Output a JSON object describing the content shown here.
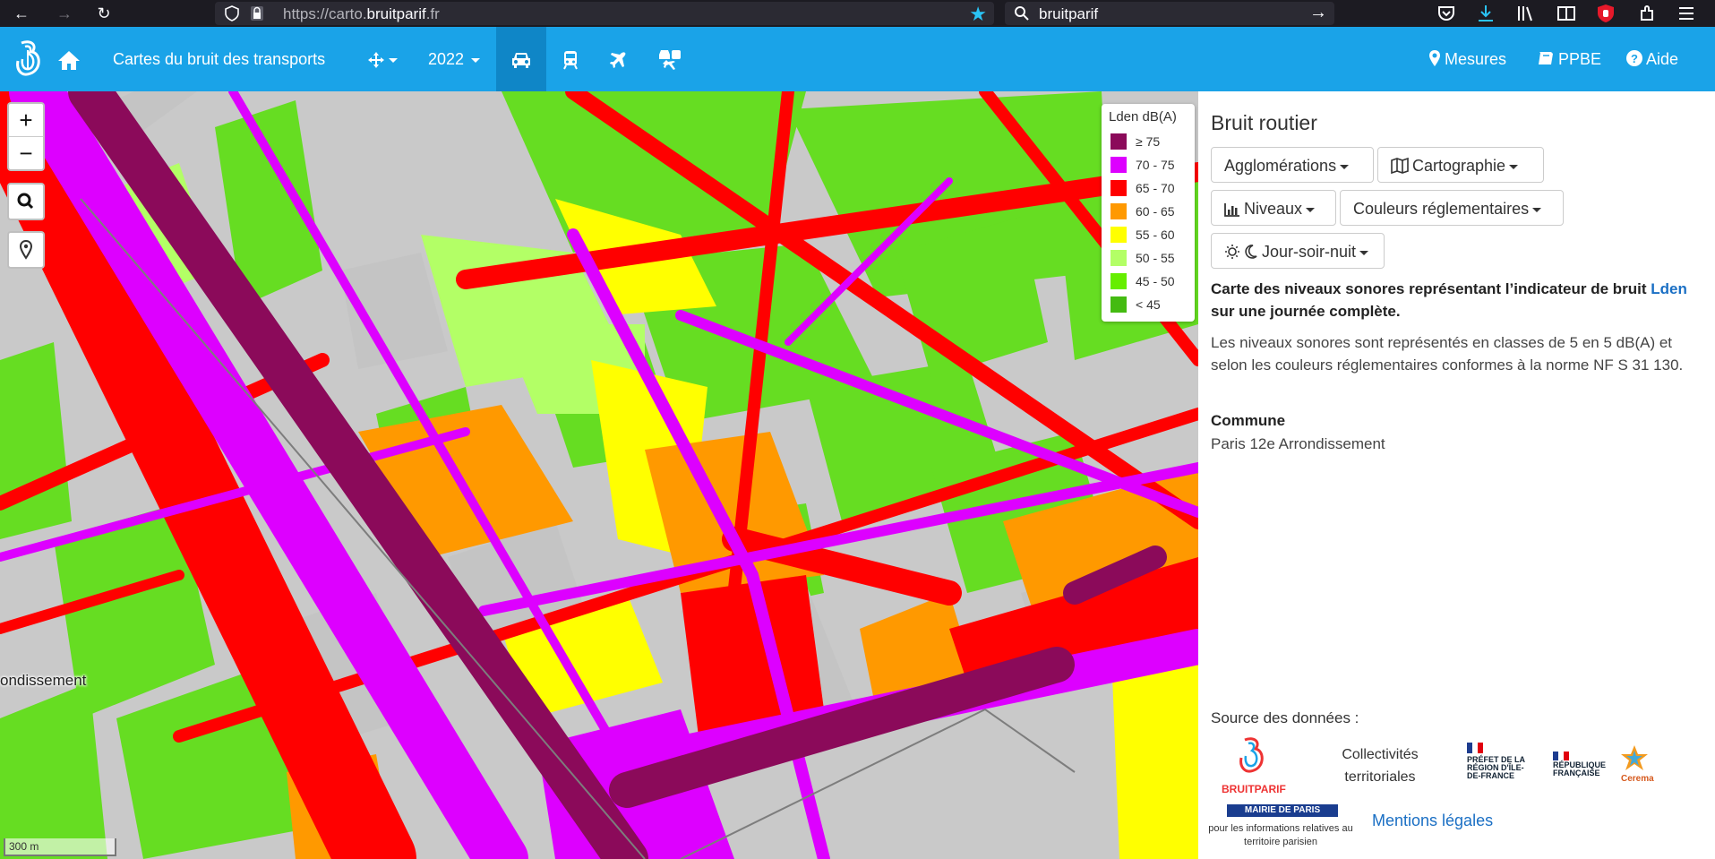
{
  "browser": {
    "url_scheme": "https://carto.",
    "url_domain": "bruitparif",
    "url_tld": ".fr",
    "search_query": "bruitparif"
  },
  "nav": {
    "title": "Cartes du bruit des transports",
    "year": "2022",
    "mesures": "Mesures",
    "ppbe": "PPBE",
    "aide": "Aide"
  },
  "map": {
    "zoom_in": "+",
    "zoom_out": "−",
    "place_label": "ondissement",
    "scale": "300 m",
    "legend": {
      "title": "Lden dB(A)",
      "items": [
        {
          "label": "≥ 75",
          "color": "#8b0a5a"
        },
        {
          "label": "70 - 75",
          "color": "#dd00ff"
        },
        {
          "label": "65 - 70",
          "color": "#ff0000"
        },
        {
          "label": "60 - 65",
          "color": "#ff9900"
        },
        {
          "label": "55 - 60",
          "color": "#ffff00"
        },
        {
          "label": "50 - 55",
          "color": "#b3ff66"
        },
        {
          "label": "45 - 50",
          "color": "#66ee00"
        },
        {
          "label": "< 45",
          "color": "#44bb11"
        }
      ]
    }
  },
  "panel": {
    "title": "Bruit routier",
    "dd_agglomerations": "Agglomérations",
    "dd_cartographie": "Cartographie",
    "dd_niveaux": "Niveaux",
    "dd_couleurs": "Couleurs réglementaires",
    "dd_periode": "Jour-soir-nuit",
    "desc_bold_1": "Carte des niveaux sonores représentant l’indicateur de bruit ",
    "desc_link": "Lden",
    "desc_bold_2": " sur une journée complète.",
    "desc": "Les niveaux sonores sont représentés en classes de 5 en 5 dB(A) et selon les couleurs réglementaires conformes à la norme NF S 31 130.",
    "commune_label": "Commune",
    "commune": "Paris 12e Arrondissement",
    "source_label": "Source des données :",
    "collectivites": "Collectivités territoriales",
    "mairie": "MAIRIE DE PARIS",
    "mairie_sub": "pour les informations relatives au territoire parisien",
    "bruitparif_logo": "BRUITPARIF",
    "prefet_logo": "PRÉFET DE LA RÉGION D'ÎLE-DE-FRANCE",
    "republique_logo": "RÉPUBLIQUE FRANÇAISE",
    "cerema_logo": "Cerema",
    "mentions": "Mentions légales"
  }
}
